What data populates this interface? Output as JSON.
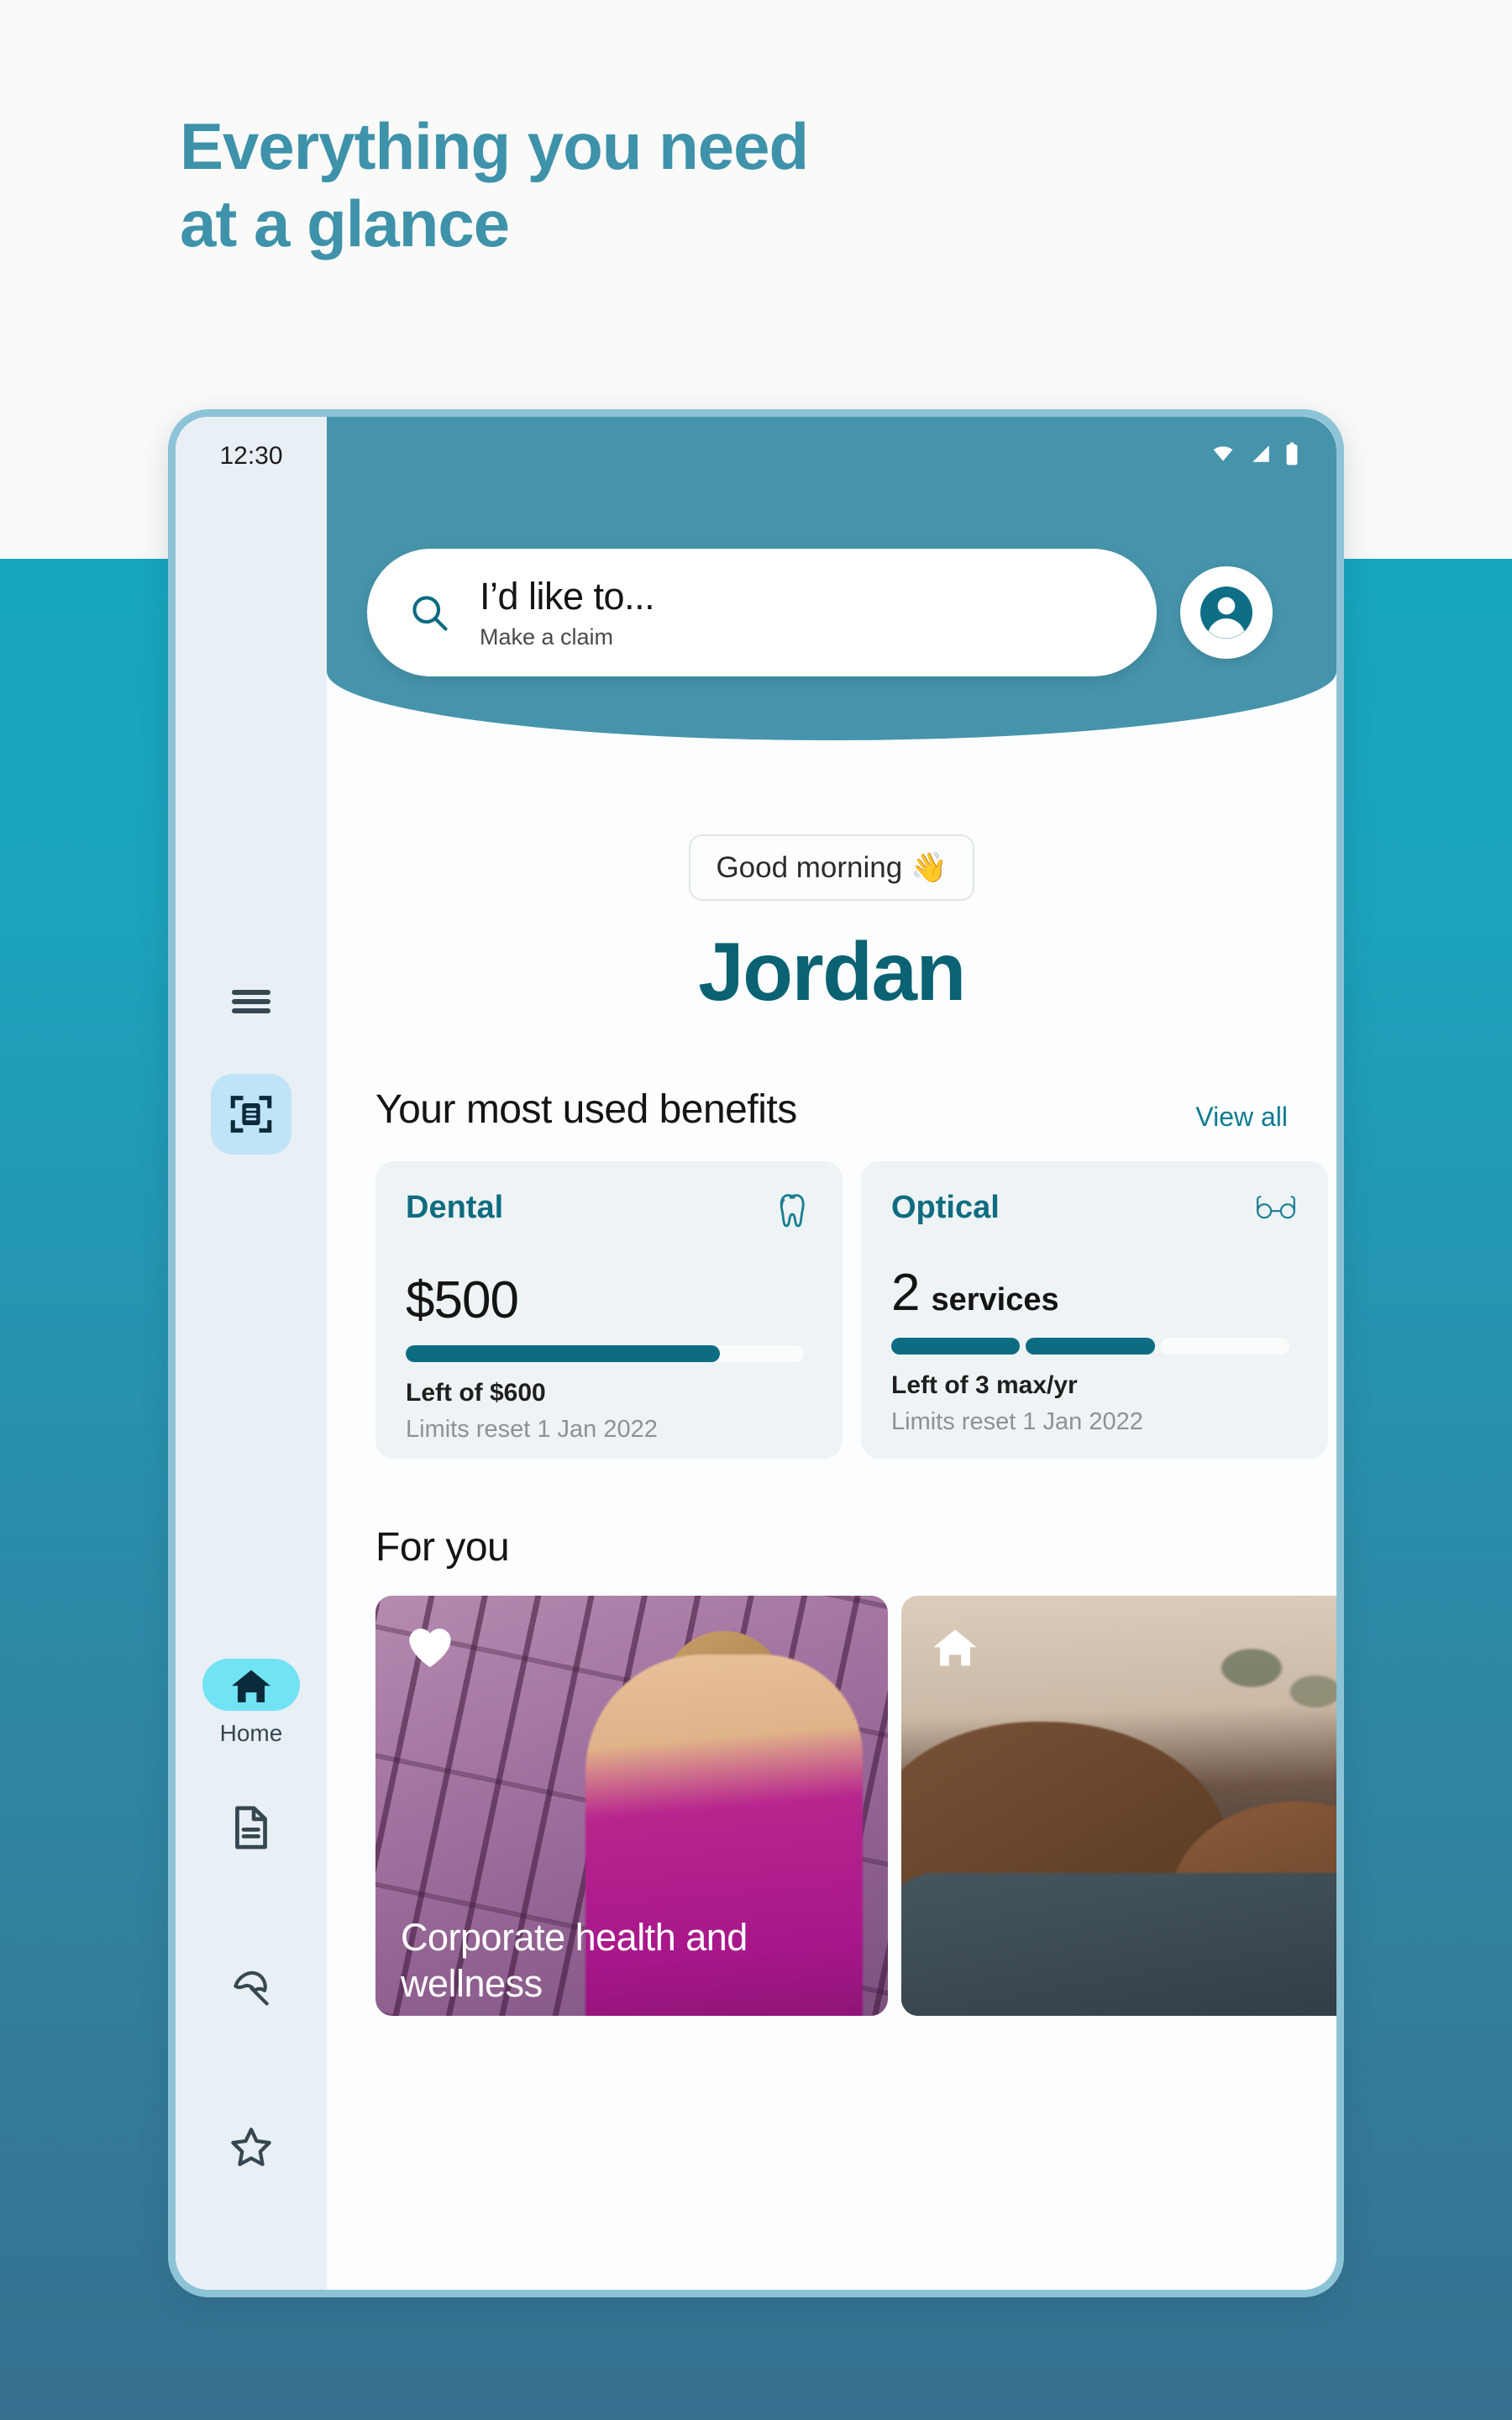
{
  "promo": {
    "headline_line1": "Everything you need",
    "headline_line2": "at a glance",
    "headline_color": "#3E92AA"
  },
  "theme": {
    "header_teal": "#4694AB",
    "brand_dark_teal": "#0A6273",
    "accent_cyan": "#72E3F5",
    "progress_fill": "#0B6C82",
    "bg_gradient_top": "#18A5BE",
    "bg_gradient_bottom": "#37708F"
  },
  "status_bar": {
    "time": "12:30",
    "icons": [
      "wifi-icon",
      "cell-signal-icon",
      "battery-icon"
    ]
  },
  "rail": {
    "menu_icon": "hamburger-menu-icon",
    "scan_icon": "scan-document-icon",
    "nav_items": [
      {
        "icon": "home-icon",
        "label": "Home",
        "active": true
      },
      {
        "icon": "document-icon",
        "label": "",
        "active": false
      },
      {
        "icon": "beach-umbrella-icon",
        "label": "",
        "active": false
      },
      {
        "icon": "star-icon",
        "label": "",
        "active": false
      }
    ]
  },
  "search": {
    "icon": "search-icon",
    "value": "I’d like to...",
    "suggestion": "Make a claim",
    "avatar_icon": "account-circle-icon"
  },
  "greeting": {
    "pill_text": "Good morning 👋",
    "user_name": "Jordan"
  },
  "benefits": {
    "section_title": "Your most used benefits",
    "view_all_label": "View all",
    "cards": [
      {
        "title": "Dental",
        "icon": "tooth-icon",
        "amount": "$500",
        "unit": "",
        "progress_type": "continuous",
        "progress_percent": 79,
        "left_text": "Left of $600",
        "reset_text": "Limits reset 1 Jan 2022"
      },
      {
        "title": "Optical",
        "icon": "glasses-icon",
        "amount": "2",
        "unit": "services",
        "progress_type": "segmented",
        "segments_total": 3,
        "segments_filled": 2,
        "left_text": "Left of 3 max/yr",
        "reset_text": "Limits reset 1 Jan 2022"
      },
      {
        "title": "",
        "icon": "",
        "amount": "",
        "unit": "",
        "progress_type": "none",
        "left_text": "",
        "reset_text": ""
      }
    ]
  },
  "for_you": {
    "section_title": "For you",
    "cards": [
      {
        "badge_icon": "heart-icon",
        "caption": "Corporate health and wellness",
        "image_alt": "woman in magenta tank top beside purple brick wall"
      },
      {
        "badge_icon": "home-icon",
        "caption": "",
        "image_alt": "smiling couple resting close together"
      }
    ]
  }
}
